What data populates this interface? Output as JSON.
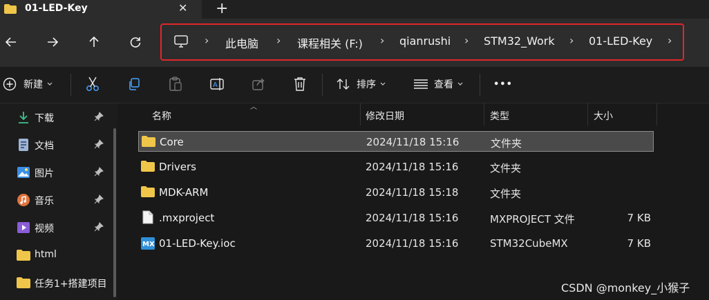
{
  "tab": {
    "title": "01-LED-Key",
    "close": "✕",
    "new_tab": "+"
  },
  "nav": {
    "back_icon": "arrow-left-icon",
    "forward_icon": "arrow-right-icon",
    "up_icon": "arrow-up-icon",
    "refresh_icon": "refresh-icon"
  },
  "breadcrumb": {
    "items": [
      "此电脑",
      "课程相关 (F:)",
      "qianrushi",
      "STM32_Work",
      "01-LED-Key"
    ],
    "separator": "›",
    "highlight_color": "#e3262a"
  },
  "toolbar": {
    "new_label": "新建",
    "sort_label": "排序",
    "view_label": "查看",
    "more_label": "•••"
  },
  "sidebar": {
    "items": [
      {
        "label": "下载",
        "icon": "download-icon",
        "pinned": true
      },
      {
        "label": "文档",
        "icon": "document-icon",
        "pinned": true
      },
      {
        "label": "图片",
        "icon": "picture-icon",
        "pinned": true
      },
      {
        "label": "音乐",
        "icon": "music-icon",
        "pinned": true
      },
      {
        "label": "视频",
        "icon": "video-icon",
        "pinned": true
      },
      {
        "label": "html",
        "icon": "folder-icon",
        "pinned": false
      },
      {
        "label": "任务1+搭建项目",
        "icon": "folder-icon",
        "pinned": false
      }
    ]
  },
  "columns": {
    "name": "名称",
    "date": "修改日期",
    "type": "类型",
    "size": "大小"
  },
  "files": [
    {
      "name": "Core",
      "date": "2024/11/18 15:16",
      "type": "文件夹",
      "size": "",
      "icon": "folder-icon",
      "selected": true
    },
    {
      "name": "Drivers",
      "date": "2024/11/18 15:16",
      "type": "文件夹",
      "size": "",
      "icon": "folder-icon",
      "selected": false
    },
    {
      "name": "MDK-ARM",
      "date": "2024/11/18 15:18",
      "type": "文件夹",
      "size": "",
      "icon": "folder-icon",
      "selected": false
    },
    {
      "name": ".mxproject",
      "date": "2024/11/18 15:16",
      "type": "MXPROJECT 文件",
      "size": "7 KB",
      "icon": "file-icon",
      "selected": false
    },
    {
      "name": "01-LED-Key.ioc",
      "date": "2024/11/18 15:16",
      "type": "STM32CubeMX",
      "size": "7 KB",
      "icon": "mx-file-icon",
      "selected": false
    }
  ],
  "watermark": "CSDN @monkey_小猴子",
  "colors": {
    "folder": "#f0c64a",
    "accent": "#4aa3ff"
  }
}
